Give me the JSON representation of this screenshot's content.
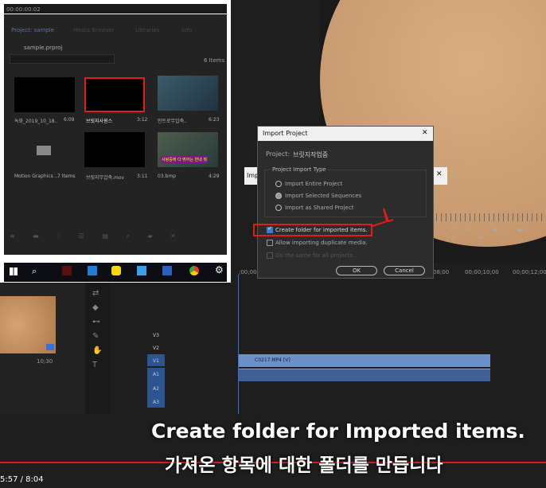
{
  "timecode_top": "00:00:00:02",
  "project_panel": {
    "tabs": [
      "Project: sample",
      "Media Browser",
      "Libraries",
      "Info"
    ],
    "file": "sample.prproj",
    "item_count": "6 Items",
    "items": [
      {
        "name": "녹화_2019_10_18..",
        "dur": "6:09"
      },
      {
        "name": "브릿지사원스",
        "dur": "3:12"
      },
      {
        "name": "인트로무압축..",
        "dur": "6:23"
      },
      {
        "name": "Motion Graphics ...",
        "dur": "7 Items"
      },
      {
        "name": "브릿지무압축.mov",
        "dur": "3:11"
      },
      {
        "name": "03.bmp",
        "dur": "4:29"
      }
    ],
    "sticker_text": "사랑중에 다 뛰어는 반내 뭐"
  },
  "dialog": {
    "title": "Import Project",
    "close": "✕",
    "project_label": "Project:",
    "project_name": "브릿지작업중",
    "group": "Project Import Type",
    "opt1": "Import Entire Project",
    "opt2": "Import Selected Sequences",
    "opt3": "Import as Shared Project",
    "chk1": "Create folder for imported items.",
    "chk2": "Allow importing duplicate media.",
    "chk3": "Do the same for all projects",
    "ok": "OK",
    "cancel": "Cancel"
  },
  "behind_dialog": {
    "title": "Imp",
    "close": "✕"
  },
  "timeline": {
    "ruler": [
      ";00;00",
      "08;00",
      "00;00;10;00",
      "00;00;12;00"
    ],
    "tracks": [
      "V3",
      "V2",
      "V1",
      "A1",
      "A2",
      "A3"
    ],
    "clip": "C0217.MP4 [V]",
    "source_tc": "10;30"
  },
  "player_time": "5:57 / 8:04",
  "captions": {
    "en": "Create folder for Imported items.",
    "ko": "가져온 항목에 대한 폴더를 만듭니다"
  },
  "colors": {
    "accent": "#e21b1b",
    "clip_blue": "#6b8fc7",
    "audio_clip": "#5a7fbf"
  }
}
